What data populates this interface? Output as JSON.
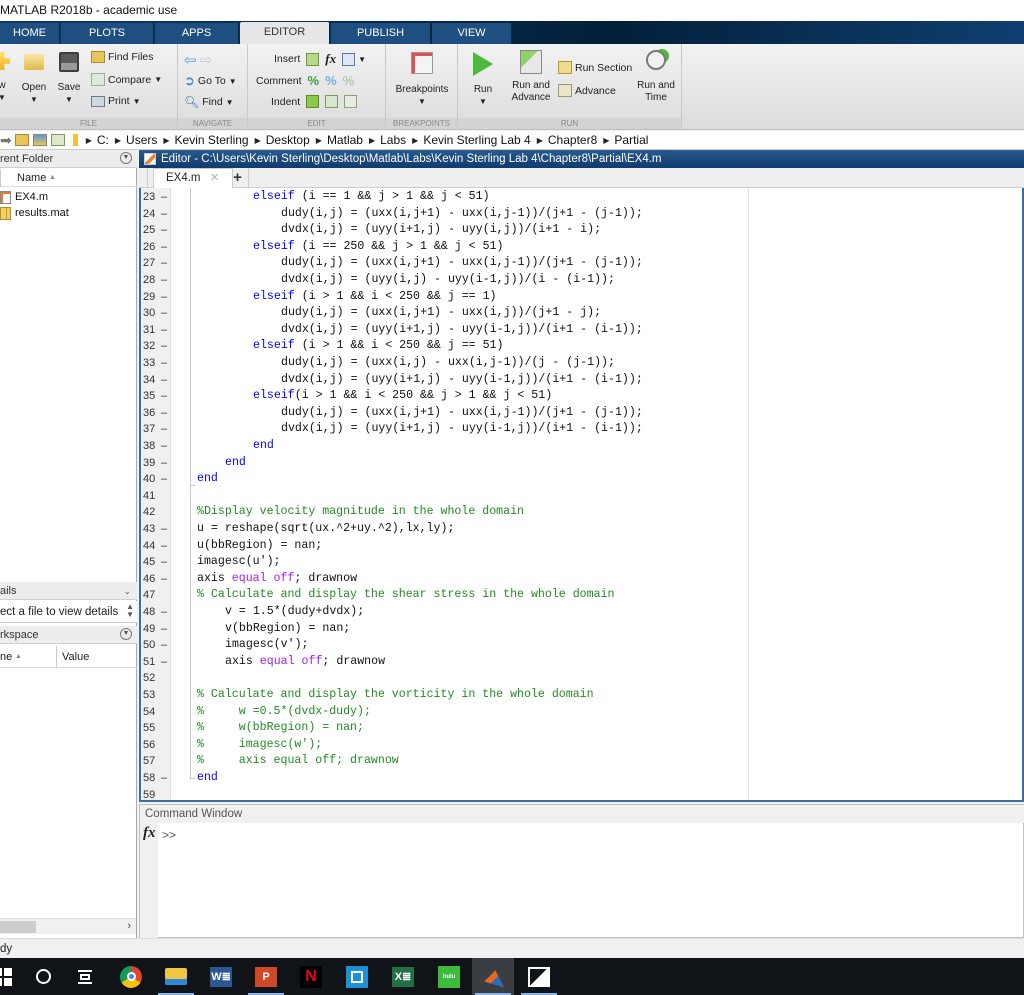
{
  "window": {
    "title": "MATLAB R2018b - academic use"
  },
  "ribbon_tabs": [
    {
      "label": "HOME",
      "active": false
    },
    {
      "label": "PLOTS",
      "active": false
    },
    {
      "label": "APPS",
      "active": false
    },
    {
      "label": "EDITOR",
      "active": true
    },
    {
      "label": "PUBLISH",
      "active": false
    },
    {
      "label": "VIEW",
      "active": false
    }
  ],
  "ribbon": {
    "file": {
      "group_label": "FILE",
      "new_label": "w",
      "open_label": "Open",
      "save_label": "Save",
      "find_files_label": "Find Files",
      "compare_label": "Compare",
      "print_label": "Print"
    },
    "navigate": {
      "group_label": "NAVIGATE",
      "goto_label": "Go To",
      "find_label": "Find"
    },
    "edit": {
      "group_label": "EDIT",
      "insert_label": "Insert",
      "fx_label": "fx",
      "comment_label": "Comment",
      "indent_label": "Indent"
    },
    "breakpoints": {
      "group_label": "BREAKPOINTS",
      "breakpoints_label": "Breakpoints"
    },
    "run": {
      "group_label": "RUN",
      "run_label": "Run",
      "run_and_advance_label_1": "Run and",
      "run_and_advance_label_2": "Advance",
      "run_section_label": "Run Section",
      "advance_label": "Advance",
      "run_and_time_label_1": "Run and",
      "run_and_time_label_2": "Time"
    }
  },
  "address_bar": {
    "path": [
      "C:",
      "Users",
      "Kevin Sterling",
      "Desktop",
      "Matlab",
      "Labs",
      "Kevin Sterling Lab 4",
      "Chapter8",
      "Partial"
    ]
  },
  "current_folder": {
    "title": "rent Folder",
    "column_name": "Name",
    "files": [
      {
        "name": "EX4.m",
        "type": "m-file"
      },
      {
        "name": "results.mat",
        "type": "mat-file"
      }
    ]
  },
  "details": {
    "title": "ails",
    "message": "ect a file to view details"
  },
  "workspace": {
    "title": "rkspace",
    "column_name": "ne",
    "column_value": "Value"
  },
  "editor": {
    "title": "Editor - C:\\Users\\Kevin Sterling\\Desktop\\Matlab\\Labs\\Kevin Sterling Lab 4\\Chapter8\\Partial\\EX4.m",
    "tabs": [
      {
        "label": "EX4.m",
        "active": true
      }
    ],
    "add_tab_label": "+",
    "lines": [
      {
        "num": "23",
        "exec": true,
        "indent": 8,
        "segments": [
          {
            "t": "elseif",
            "c": "kw"
          },
          {
            "t": " (i == 1 && j > 1 && j < 51)",
            "c": ""
          }
        ]
      },
      {
        "num": "24",
        "exec": true,
        "indent": 12,
        "segments": [
          {
            "t": "dudy(i,j) = (uxx(i,j+1) - uxx(i,j-1))/(j+1 - (j-1));",
            "c": ""
          }
        ]
      },
      {
        "num": "25",
        "exec": true,
        "indent": 12,
        "segments": [
          {
            "t": "dvdx(i,j) = (uyy(i+1,j) - uyy(i,j))/(i+1 - i);",
            "c": ""
          }
        ]
      },
      {
        "num": "26",
        "exec": true,
        "indent": 8,
        "segments": [
          {
            "t": "elseif",
            "c": "kw"
          },
          {
            "t": " (i == 250 && j > 1 && j < 51)",
            "c": ""
          }
        ]
      },
      {
        "num": "27",
        "exec": true,
        "indent": 12,
        "segments": [
          {
            "t": "dudy(i,j) = (uxx(i,j+1) - uxx(i,j-1))/(j+1 - (j-1));",
            "c": ""
          }
        ]
      },
      {
        "num": "28",
        "exec": true,
        "indent": 12,
        "segments": [
          {
            "t": "dvdx(i,j) = (uyy(i,j) - uyy(i-1,j))/(i - (i-1));",
            "c": ""
          }
        ]
      },
      {
        "num": "29",
        "exec": true,
        "indent": 8,
        "segments": [
          {
            "t": "elseif",
            "c": "kw"
          },
          {
            "t": " (i > 1 && i < 250 && j == 1)",
            "c": ""
          }
        ]
      },
      {
        "num": "30",
        "exec": true,
        "indent": 12,
        "segments": [
          {
            "t": "dudy(i,j) = (uxx(i,j+1) - uxx(i,j))/(j+1 - j);",
            "c": ""
          }
        ]
      },
      {
        "num": "31",
        "exec": true,
        "indent": 12,
        "segments": [
          {
            "t": "dvdx(i,j) = (uyy(i+1,j) - uyy(i-1,j))/(i+1 - (i-1));",
            "c": ""
          }
        ]
      },
      {
        "num": "32",
        "exec": true,
        "indent": 8,
        "segments": [
          {
            "t": "elseif",
            "c": "kw"
          },
          {
            "t": " (i > 1 && i < 250 && j == 51)",
            "c": ""
          }
        ]
      },
      {
        "num": "33",
        "exec": true,
        "indent": 12,
        "segments": [
          {
            "t": "dudy(i,j) = (uxx(i,j) - uxx(i,j-1))/(j - (j-1));",
            "c": ""
          }
        ]
      },
      {
        "num": "34",
        "exec": true,
        "indent": 12,
        "segments": [
          {
            "t": "dvdx(i,j) = (uyy(i+1,j) - uyy(i-1,j))/(i+1 - (i-1));",
            "c": ""
          }
        ]
      },
      {
        "num": "35",
        "exec": true,
        "indent": 8,
        "segments": [
          {
            "t": "elseif",
            "c": "kw"
          },
          {
            "t": "(i > 1 && i < 250 && j > 1 && j < 51)",
            "c": ""
          }
        ]
      },
      {
        "num": "36",
        "exec": true,
        "indent": 12,
        "segments": [
          {
            "t": "dudy(i,j) = (uxx(i,j+1) - uxx(i,j-1))/(j+1 - (j-1));",
            "c": ""
          }
        ]
      },
      {
        "num": "37",
        "exec": true,
        "indent": 12,
        "segments": [
          {
            "t": "dvdx(i,j) = (uyy(i+1,j) - uyy(i-1,j))/(i+1 - (i-1));",
            "c": ""
          }
        ]
      },
      {
        "num": "38",
        "exec": true,
        "indent": 8,
        "segments": [
          {
            "t": "end",
            "c": "kw"
          }
        ]
      },
      {
        "num": "39",
        "exec": true,
        "indent": 4,
        "segments": [
          {
            "t": "end",
            "c": "kw"
          }
        ]
      },
      {
        "num": "40",
        "exec": true,
        "indent": 0,
        "segments": [
          {
            "t": "end",
            "c": "kw"
          }
        ]
      },
      {
        "num": "41",
        "exec": false,
        "indent": 0,
        "segments": []
      },
      {
        "num": "42",
        "exec": false,
        "indent": 0,
        "segments": [
          {
            "t": "%Display velocity magnitude in the whole domain",
            "c": "cm"
          }
        ]
      },
      {
        "num": "43",
        "exec": true,
        "indent": 0,
        "segments": [
          {
            "t": "u = reshape(sqrt(ux.^2+uy.^2),lx,ly);",
            "c": ""
          }
        ]
      },
      {
        "num": "44",
        "exec": true,
        "indent": 0,
        "segments": [
          {
            "t": "u(bbRegion) = nan;",
            "c": ""
          }
        ]
      },
      {
        "num": "45",
        "exec": true,
        "indent": 0,
        "segments": [
          {
            "t": "imagesc(u');",
            "c": ""
          }
        ]
      },
      {
        "num": "46",
        "exec": true,
        "indent": 0,
        "segments": [
          {
            "t": "axis ",
            "c": ""
          },
          {
            "t": "equal off",
            "c": "st"
          },
          {
            "t": "; drawnow",
            "c": ""
          }
        ]
      },
      {
        "num": "47",
        "exec": false,
        "indent": 0,
        "segments": [
          {
            "t": "% Calculate and display the shear stress in the whole domain",
            "c": "cm"
          }
        ]
      },
      {
        "num": "48",
        "exec": true,
        "indent": 4,
        "segments": [
          {
            "t": "v = 1.5*(dudy+dvdx);",
            "c": ""
          }
        ]
      },
      {
        "num": "49",
        "exec": true,
        "indent": 4,
        "segments": [
          {
            "t": "v(bbRegion) = nan;",
            "c": ""
          }
        ]
      },
      {
        "num": "50",
        "exec": true,
        "indent": 4,
        "segments": [
          {
            "t": "imagesc(v');",
            "c": ""
          }
        ]
      },
      {
        "num": "51",
        "exec": true,
        "indent": 4,
        "segments": [
          {
            "t": "axis ",
            "c": ""
          },
          {
            "t": "equal off",
            "c": "st"
          },
          {
            "t": "; drawnow",
            "c": ""
          }
        ]
      },
      {
        "num": "52",
        "exec": false,
        "indent": 0,
        "segments": []
      },
      {
        "num": "53",
        "exec": false,
        "indent": 0,
        "segments": [
          {
            "t": "% Calculate and display the vorticity in the whole domain",
            "c": "cm"
          }
        ]
      },
      {
        "num": "54",
        "exec": false,
        "indent": 0,
        "segments": [
          {
            "t": "%     w =0.5*(dvdx-dudy);",
            "c": "cm"
          }
        ]
      },
      {
        "num": "55",
        "exec": false,
        "indent": 0,
        "segments": [
          {
            "t": "%     w(bbRegion) = nan;",
            "c": "cm"
          }
        ]
      },
      {
        "num": "56",
        "exec": false,
        "indent": 0,
        "segments": [
          {
            "t": "%     imagesc(w');",
            "c": "cm"
          }
        ]
      },
      {
        "num": "57",
        "exec": false,
        "indent": 0,
        "segments": [
          {
            "t": "%     axis equal off; drawnow",
            "c": "cm"
          }
        ]
      },
      {
        "num": "58",
        "exec": true,
        "indent": 0,
        "segments": [
          {
            "t": "end",
            "c": "kw"
          }
        ]
      },
      {
        "num": "59",
        "exec": false,
        "indent": 0,
        "segments": []
      }
    ]
  },
  "command_window": {
    "title": "Command Window",
    "fx_label": "fx",
    "prompt": ">>"
  },
  "status_bar": {
    "text": "dy"
  },
  "taskbar": {
    "items": [
      {
        "name": "start-icon"
      },
      {
        "name": "cortana-search-icon"
      },
      {
        "name": "task-view-icon"
      },
      {
        "name": "chrome-icon"
      },
      {
        "name": "file-explorer-icon"
      },
      {
        "name": "word-icon"
      },
      {
        "name": "powerpoint-icon"
      },
      {
        "name": "netflix-icon"
      },
      {
        "name": "phone-companion-icon"
      },
      {
        "name": "excel-icon"
      },
      {
        "name": "hulu-icon",
        "label": "hulu"
      },
      {
        "name": "matlab-icon"
      },
      {
        "name": "photos-icon"
      }
    ]
  },
  "colors": {
    "keyword": "#0000ff",
    "comment": "#228b22",
    "string": "#a020f0",
    "editor_title": "#1a4a7e",
    "tab_strip": "#032039"
  }
}
